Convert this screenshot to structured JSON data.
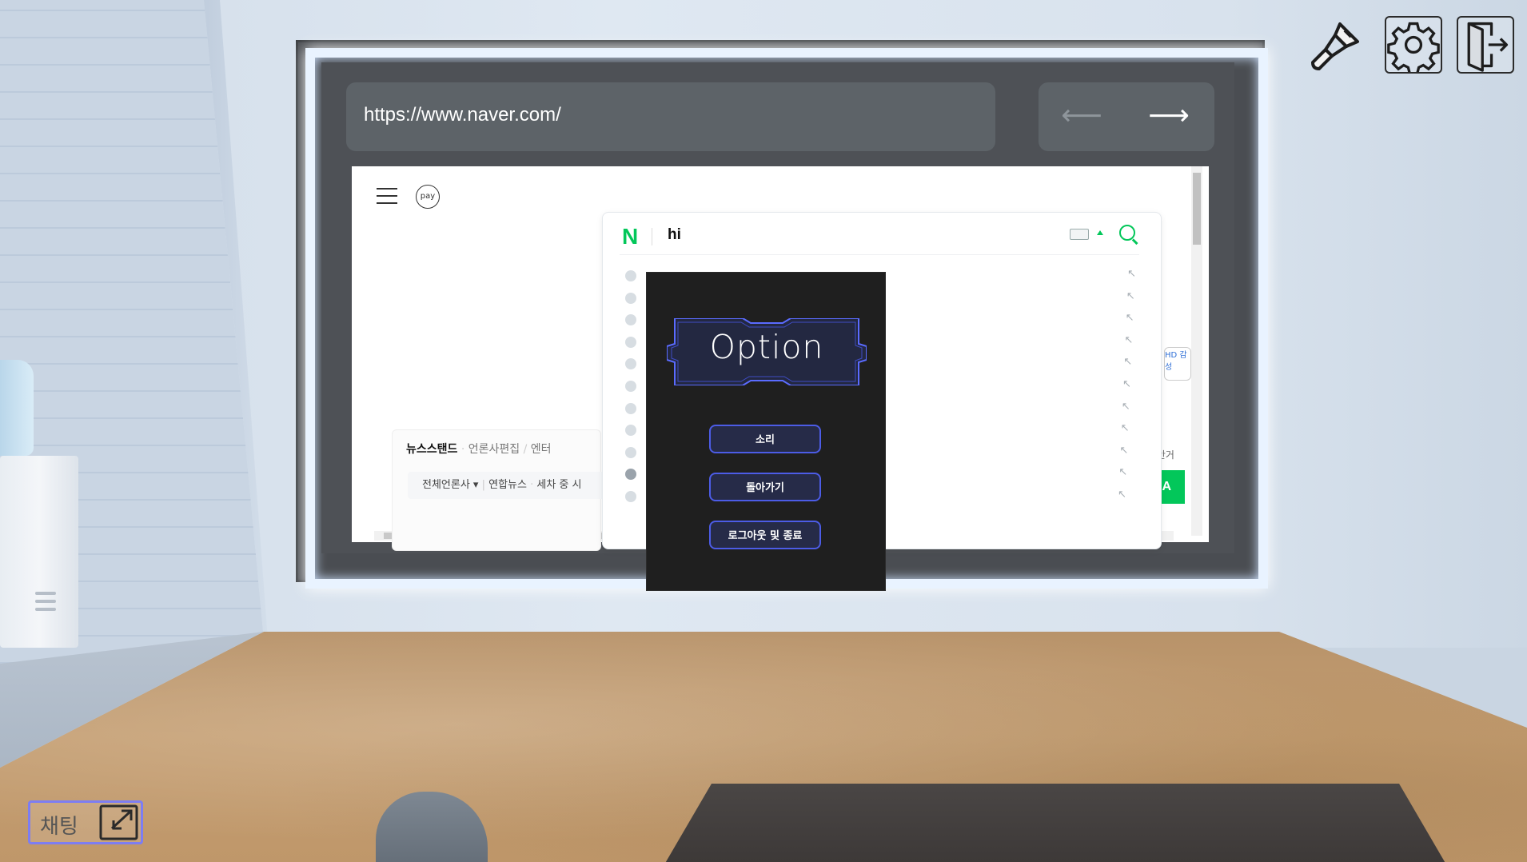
{
  "browser": {
    "url": "https://www.naver.com/",
    "nav": {
      "back_icon": "arrow-left-icon",
      "forward_icon": "arrow-right-icon"
    }
  },
  "naver": {
    "pay_label": "pay",
    "search_query": "hi",
    "suggestion_count": 11,
    "news_tabs": {
      "active": "뉴스스탠드",
      "t2": "언론사편집",
      "t3": "엔터"
    },
    "news_sub": {
      "dropdown": "전체언론사 ▾",
      "item1": "연합뉴스",
      "item2": "세차 중 시"
    },
    "right_snippet_top": "더 안거",
    "right_snippet_bottom": "기",
    "right_green_text": "NA",
    "right_card_text": "HD 감성"
  },
  "modal": {
    "title": "Option",
    "buttons": [
      {
        "label": "소리"
      },
      {
        "label": "돌아가기"
      },
      {
        "label": "로그아웃 및 종료"
      }
    ]
  },
  "hud": {
    "icons": [
      "paint-brush-icon",
      "gear-icon",
      "exit-door-icon"
    ]
  },
  "chat": {
    "label": "채팅",
    "icon": "expand-arrow-icon"
  },
  "colors": {
    "accent": "#4c5ce6",
    "modal_bg": "#1f1f1f",
    "naver_green": "#03c75a",
    "chat_border": "#7d7df2"
  }
}
